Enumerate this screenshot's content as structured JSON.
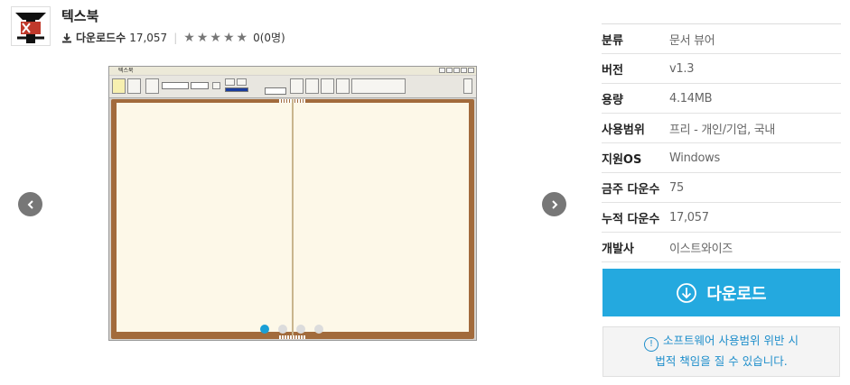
{
  "app": {
    "title": "텍스북",
    "download_label": "다운로드수",
    "download_count": "17,057",
    "rating_stars": 0,
    "rating_text": "0(0명)"
  },
  "screenshot": {
    "window_title": "텍스북",
    "slides": 4,
    "active_slide": 1
  },
  "info": [
    {
      "label": "분류",
      "value": "문서 뷰어"
    },
    {
      "label": "버전",
      "value": "v1.3"
    },
    {
      "label": "용량",
      "value": "4.14MB"
    },
    {
      "label": "사용범위",
      "value": "프리 - 개인/기업, 국내"
    },
    {
      "label": "지원OS",
      "value": "Windows"
    },
    {
      "label": "금주 다운수",
      "value": "75"
    },
    {
      "label": "누적 다운수",
      "value": "17,057"
    },
    {
      "label": "개발사",
      "value": "이스트와이즈"
    }
  ],
  "download_button": {
    "label": "다운로드"
  },
  "notice": {
    "line1": "소프트웨어 사용범위 위반 시",
    "line2": "법적 책임을 질 수 있습니다.",
    "icon": "!"
  },
  "colors": {
    "accent": "#24a9df",
    "notice_text": "#1e8ecb",
    "book_cover": "#a26b3c",
    "page": "#fdf8e8"
  }
}
